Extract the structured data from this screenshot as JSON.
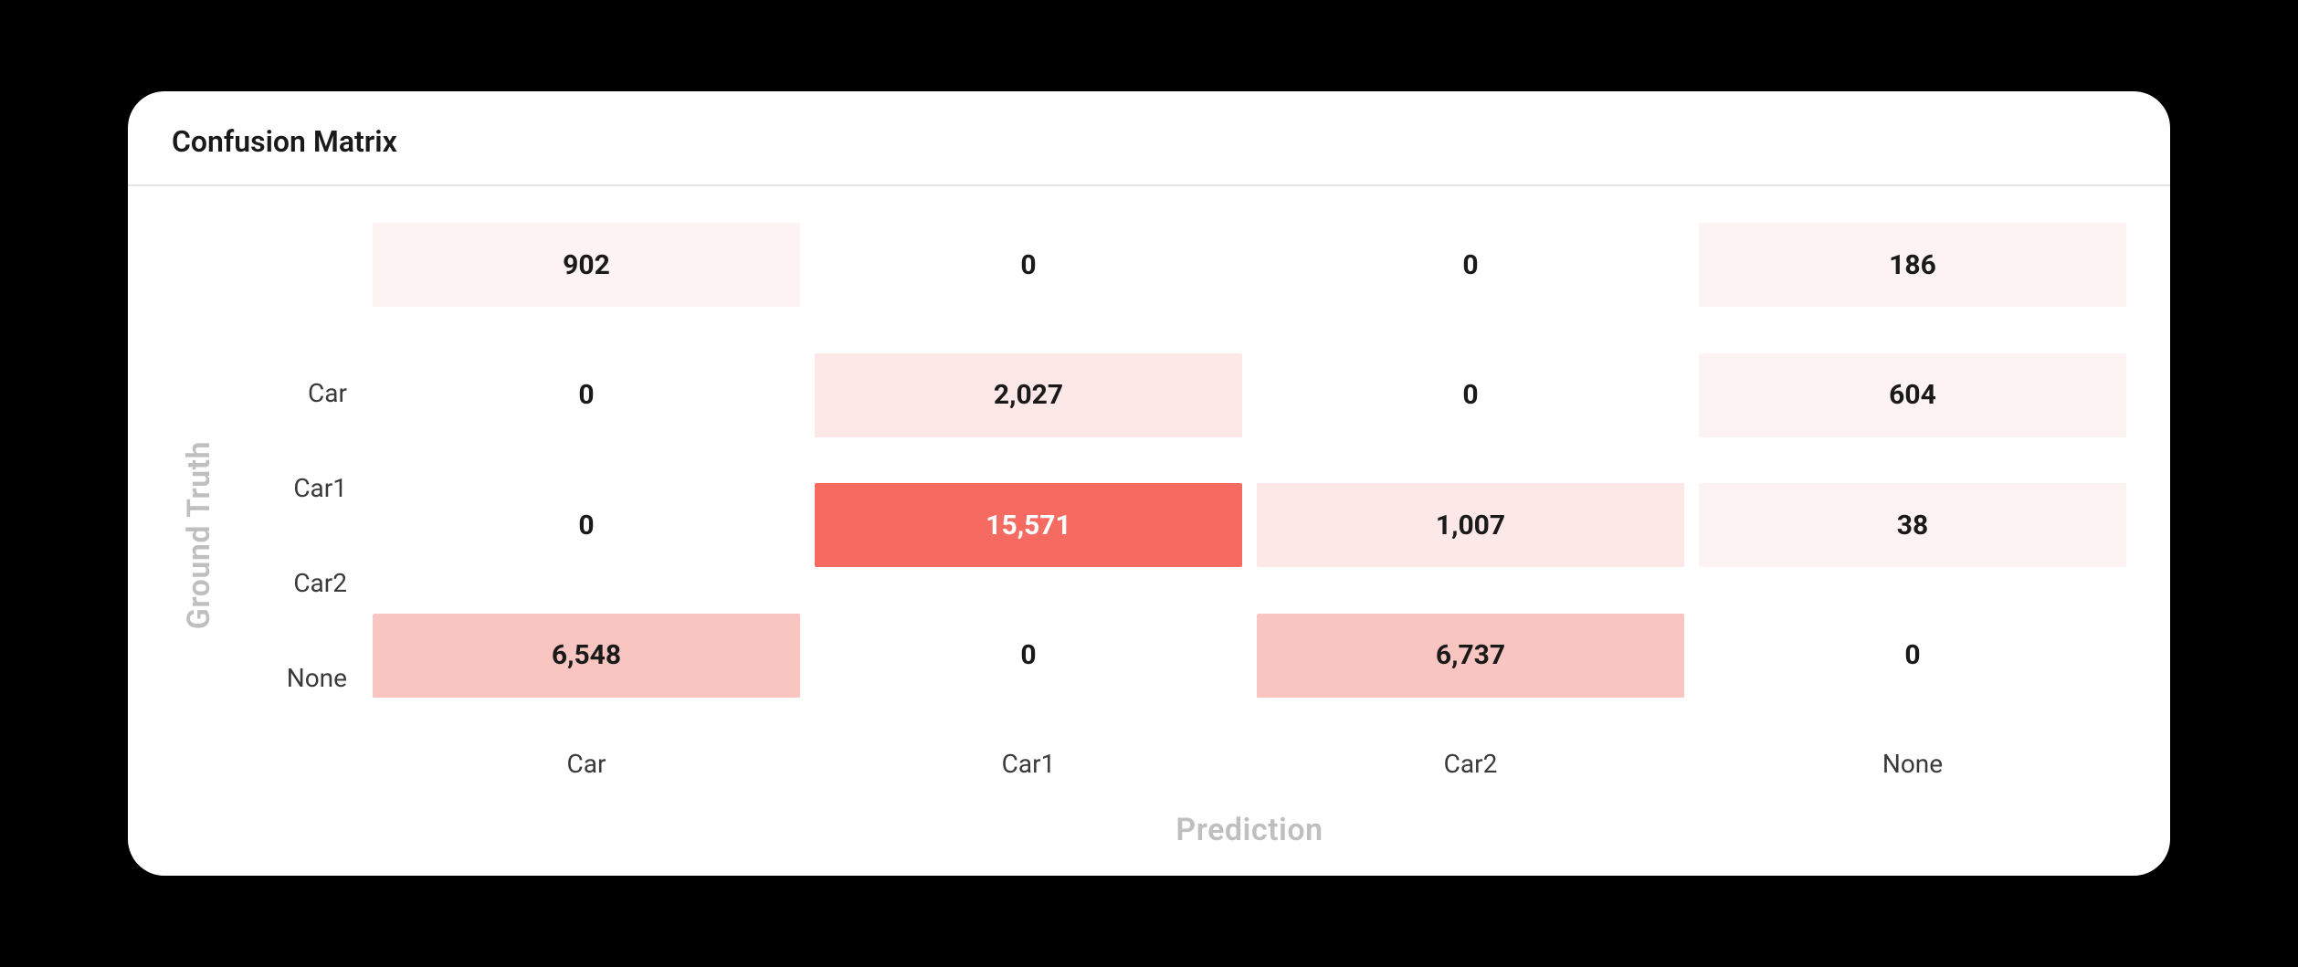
{
  "title": "Confusion Matrix",
  "y_axis_label": "Ground Truth",
  "x_axis_label": "Prediction",
  "row_labels": [
    "Car",
    "Car1",
    "Car2",
    "None"
  ],
  "col_labels": [
    "Car",
    "Car1",
    "Car2",
    "None"
  ],
  "cells": {
    "r0c0": "902",
    "r0c1": "0",
    "r0c2": "0",
    "r0c3": "186",
    "r1c0": "0",
    "r1c1": "2,027",
    "r1c2": "0",
    "r1c3": "604",
    "r2c0": "0",
    "r2c1": "15,571",
    "r2c2": "1,007",
    "r2c3": "38",
    "r3c0": "6,548",
    "r3c1": "0",
    "r3c2": "6,737",
    "r3c3": "0"
  },
  "chart_data": {
    "type": "heatmap",
    "title": "Confusion Matrix",
    "xlabel": "Prediction",
    "ylabel": "Ground Truth",
    "x_categories": [
      "Car",
      "Car1",
      "Car2",
      "None"
    ],
    "y_categories": [
      "Car",
      "Car1",
      "Car2",
      "None"
    ],
    "values": [
      [
        902,
        0,
        0,
        186
      ],
      [
        0,
        2027,
        0,
        604
      ],
      [
        0,
        15571,
        1007,
        38
      ],
      [
        6548,
        0,
        6737,
        0
      ]
    ],
    "color_scale": {
      "low": "#ffffff",
      "high": "#f56a61"
    }
  }
}
